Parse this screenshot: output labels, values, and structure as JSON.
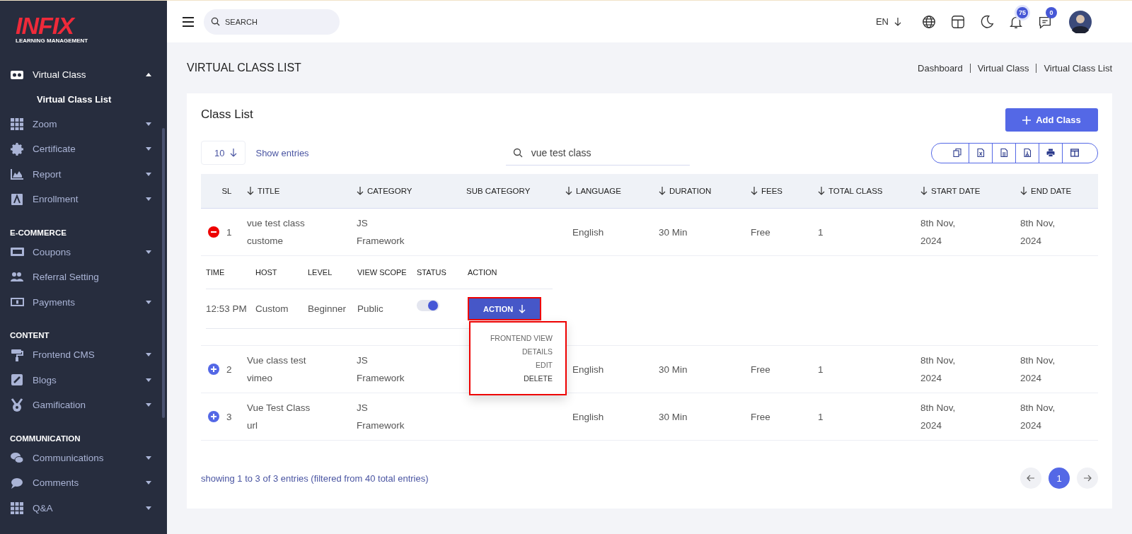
{
  "logo": {
    "brand": "INFIX",
    "tagline": "LEARNING MANAGEMENT"
  },
  "sidebar": {
    "groups": [
      {
        "items": [
          {
            "label": "Virtual Class",
            "selected": true,
            "expanded": true,
            "children": [
              {
                "label": "Virtual Class List",
                "selected": true
              }
            ]
          },
          {
            "label": "Zoom",
            "selected": false,
            "expanded": false
          },
          {
            "label": "Certificate",
            "selected": false,
            "expanded": false
          },
          {
            "label": "Report",
            "selected": false,
            "expanded": false
          },
          {
            "label": "Enrollment",
            "selected": false,
            "expanded": false
          }
        ]
      },
      {
        "heading": "E-COMMERCE",
        "items": [
          {
            "label": "Coupons",
            "selected": false,
            "expanded": false
          },
          {
            "label": "Referral Setting",
            "selected": false
          },
          {
            "label": "Payments",
            "selected": false,
            "expanded": false
          }
        ]
      },
      {
        "heading": "CONTENT",
        "items": [
          {
            "label": "Frontend CMS",
            "selected": false,
            "expanded": false
          },
          {
            "label": "Blogs",
            "selected": false,
            "expanded": false
          },
          {
            "label": "Gamification",
            "selected": false,
            "expanded": false
          }
        ]
      },
      {
        "heading": "COMMUNICATION",
        "items": [
          {
            "label": "Communications",
            "selected": false,
            "expanded": false
          },
          {
            "label": "Comments",
            "selected": false,
            "expanded": false
          },
          {
            "label": "Q&A",
            "selected": false,
            "expanded": false
          }
        ]
      }
    ]
  },
  "topbar": {
    "search": {
      "placeholder": "SEARCH"
    },
    "language": "EN",
    "notifications": "75",
    "messages": "0"
  },
  "page": {
    "title": "VIRTUAL CLASS LIST",
    "breadcrumb": [
      "Dashboard",
      "Virtual Class",
      "Virtual Class List"
    ]
  },
  "card": {
    "title": "Class List",
    "add_button": "Add Class",
    "page_size": "10",
    "page_size_label": "Show entries",
    "search": {
      "value": "vue test class"
    },
    "table": {
      "columns": [
        {
          "label": "SL",
          "sortable": false
        },
        {
          "label": "TITLE",
          "sortable": true
        },
        {
          "label": "CATEGORY",
          "sortable": true
        },
        {
          "label": "SUB CATEGORY",
          "sortable": false
        },
        {
          "label": "LANGUAGE",
          "sortable": true
        },
        {
          "label": "DURATION",
          "sortable": true
        },
        {
          "label": "FEES",
          "sortable": true
        },
        {
          "label": "TOTAL CLASS",
          "sortable": true
        },
        {
          "label": "START DATE",
          "sortable": true
        },
        {
          "label": "END DATE",
          "sortable": true
        }
      ],
      "detail_columns": [
        "TIME",
        "HOST",
        "LEVEL",
        "VIEW SCOPE",
        "STATUS",
        "ACTION"
      ],
      "rows": [
        {
          "sl": "1",
          "expanded": true,
          "title": "vue test class custome",
          "category": "JS Framework",
          "language": "English",
          "duration": "30 Min",
          "fees": "Free",
          "total_class": "1",
          "start_date": "8th Nov, 2024",
          "end_date": "8th Nov, 2024",
          "details": {
            "time": "12:53 PM",
            "host": "Custom",
            "level": "Beginner",
            "view_scope": "Public",
            "status_on": true,
            "action": "ACTION",
            "menu": [
              {
                "label": "FRONTEND VIEW",
                "selected": false
              },
              {
                "label": "DETAILS",
                "selected": false
              },
              {
                "label": "EDIT",
                "selected": false
              },
              {
                "label": "DELETE",
                "selected": true
              }
            ]
          }
        },
        {
          "sl": "2",
          "expanded": false,
          "title": "Vue class test vimeo",
          "category": "JS Framework",
          "language": "English",
          "duration": "30 Min",
          "fees": "Free",
          "total_class": "1",
          "start_date": "8th Nov, 2024",
          "end_date": "8th Nov, 2024"
        },
        {
          "sl": "3",
          "expanded": false,
          "title": "Vue Test Class url",
          "category": "JS Framework",
          "language": "English",
          "duration": "30 Min",
          "fees": "Free",
          "total_class": "1",
          "start_date": "8th Nov, 2024",
          "end_date": "8th Nov, 2024"
        }
      ]
    },
    "info": "showing 1 to 3 of 3 entries (filtered from 40 total entries)",
    "pagination": [
      {
        "label": "1",
        "selected": true
      }
    ]
  }
}
